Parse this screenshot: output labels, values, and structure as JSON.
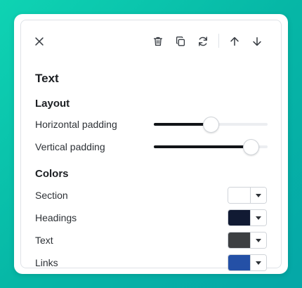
{
  "panel": {
    "title": "Text",
    "toolbar": {
      "icons": [
        "close-icon",
        "trash-icon",
        "copy-icon",
        "refresh-icon",
        "arrow-up-icon",
        "arrow-down-icon"
      ]
    },
    "layout": {
      "heading": "Layout",
      "horizontal_padding": {
        "label": "Horizontal padding",
        "value_fraction": 0.5
      },
      "vertical_padding": {
        "label": "Vertical padding",
        "value_fraction": 0.85
      }
    },
    "colors": {
      "heading": "Colors",
      "items": [
        {
          "label": "Section",
          "color": "#ffffff"
        },
        {
          "label": "Headings",
          "color": "#111a33"
        },
        {
          "label": "Text",
          "color": "#3d3f42"
        },
        {
          "label": "Links",
          "color": "#2450a6"
        }
      ]
    }
  },
  "theme": {
    "background_gradient": [
      "#0fd3b3",
      "#05a7a7"
    ]
  }
}
